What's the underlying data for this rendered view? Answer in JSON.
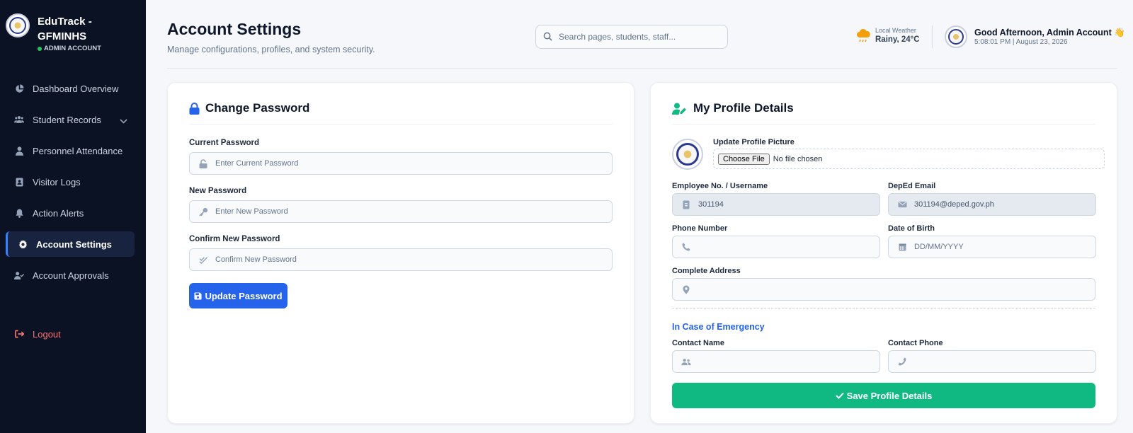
{
  "app": {
    "name": "EduTrack - GFMINHS",
    "role": "ADMIN ACCOUNT"
  },
  "sidebar": {
    "items": [
      {
        "label": "Dashboard Overview",
        "icon": "chart-pie-icon"
      },
      {
        "label": "Student Records",
        "icon": "users-icon"
      },
      {
        "label": "Personnel Attendance",
        "icon": "user-tie-icon"
      },
      {
        "label": "Visitor Logs",
        "icon": "address-book-icon"
      },
      {
        "label": "Action Alerts",
        "icon": "bell-icon"
      },
      {
        "label": "Account Settings",
        "icon": "gear-icon",
        "active": true
      },
      {
        "label": "Account Approvals",
        "icon": "user-check-icon"
      }
    ],
    "logout": "Logout"
  },
  "header": {
    "title": "Account Settings",
    "subtitle": "Manage configurations, profiles, and system security.",
    "search_placeholder": "Search pages, students, staff...",
    "weather_label": "Local Weather",
    "weather_value": "Rainy, 24°C",
    "greeting": "Good Afternoon, Admin Account 👋",
    "datetime": "5:08:01 PM | August 23, 2026"
  },
  "password_card": {
    "title": "Change Password",
    "current_label": "Current Password",
    "current_placeholder": "Enter Current Password",
    "new_label": "New Password",
    "new_placeholder": "Enter New Password",
    "confirm_label": "Confirm New Password",
    "confirm_placeholder": "Confirm New Password",
    "button": "Update Password"
  },
  "profile_card": {
    "title": "My Profile Details",
    "picture_label": "Update Profile Picture",
    "choose_file": "Choose File",
    "file_status": "No file chosen",
    "employee_label": "Employee No. / Username",
    "employee_value": "301194",
    "email_label": "DepEd Email",
    "email_value": "301194@deped.gov.ph",
    "phone_label": "Phone Number",
    "phone_value": "",
    "dob_label": "Date of Birth",
    "dob_placeholder": "DD/MM/YYYY",
    "address_label": "Complete Address",
    "address_value": "",
    "emergency_heading": "In Case of Emergency",
    "contact_name_label": "Contact Name",
    "contact_name_value": "",
    "contact_phone_label": "Contact Phone",
    "contact_phone_value": "",
    "button": "Save Profile Details"
  },
  "colors": {
    "sidebar_bg": "#0b1223",
    "primary": "#2563eb",
    "success": "#10b981",
    "logout": "#f87171"
  }
}
